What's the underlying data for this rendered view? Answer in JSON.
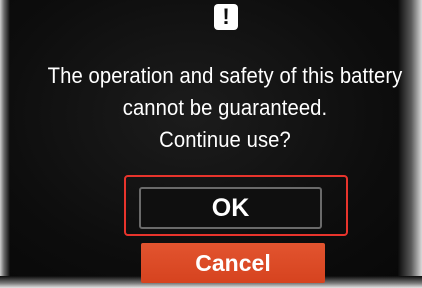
{
  "dialog": {
    "icon": "exclamation-warning-icon",
    "icon_glyph": "!",
    "message_lines": [
      "The operation and safety of this battery",
      "cannot be guaranteed.",
      "Continue use?"
    ],
    "ok_label": "OK",
    "cancel_label": "Cancel",
    "highlight_color": "#e8342c",
    "cancel_color": "#d6431f"
  }
}
